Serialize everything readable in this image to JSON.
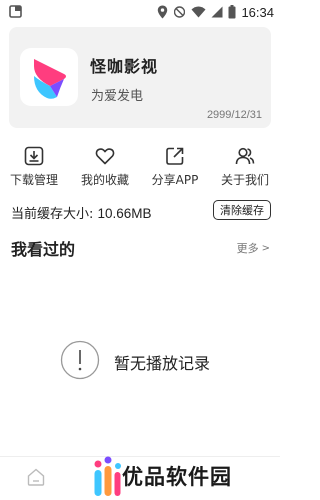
{
  "status_bar": {
    "time": "16:34"
  },
  "app_card": {
    "name": "怪咖影视",
    "slogan": "为爱发电",
    "expiry": "2999/12/31",
    "logo_colors": {
      "pink": "#ff3d7f",
      "blue": "#3ec6ff",
      "purple": "#7b4dff"
    }
  },
  "quick_actions": [
    {
      "label": "下载管理",
      "icon": "download-icon"
    },
    {
      "label": "我的收藏",
      "icon": "heart-icon"
    },
    {
      "label": "分享APP",
      "icon": "share-icon"
    },
    {
      "label": "关于我们",
      "icon": "users-icon"
    }
  ],
  "cache": {
    "label": "当前缓存大小: ",
    "value": "10.66MB",
    "clear_label": "清除缓存"
  },
  "history": {
    "title": "我看过的",
    "more_label": "更多",
    "more_chevron": ">",
    "empty_text": "暂无播放记录"
  },
  "bottom_nav": {
    "home_icon": "home-icon"
  },
  "watermark": {
    "text": "优品软件园"
  }
}
